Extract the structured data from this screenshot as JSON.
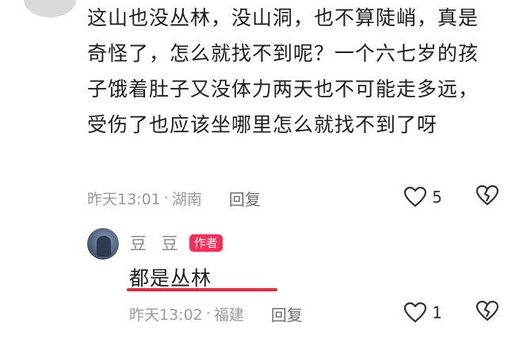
{
  "comment": {
    "text": "这山也没丛林，没山洞，也不算陡峭，真是奇怪了，怎么就找不到呢？一个六七岁的孩子饿着肚子又没体力两天也不可能走多远，受伤了也应该坐哪里怎么就找不到了呀",
    "time": "昨天13:01",
    "separator": "·",
    "location": "湖南",
    "reply_label": "回复",
    "like_count": "5"
  },
  "reply": {
    "user_name": "豆 豆",
    "badge": "作者",
    "text": "都是丛林",
    "time": "昨天13:02",
    "separator": "·",
    "location": "福建",
    "reply_label": "回复",
    "like_count": "1"
  },
  "colors": {
    "badge_bg": "#ff2d55",
    "underline": "#e8283c",
    "meta_text": "#9a9a9a"
  },
  "icons": [
    "heart-icon",
    "broken-heart-icon"
  ]
}
